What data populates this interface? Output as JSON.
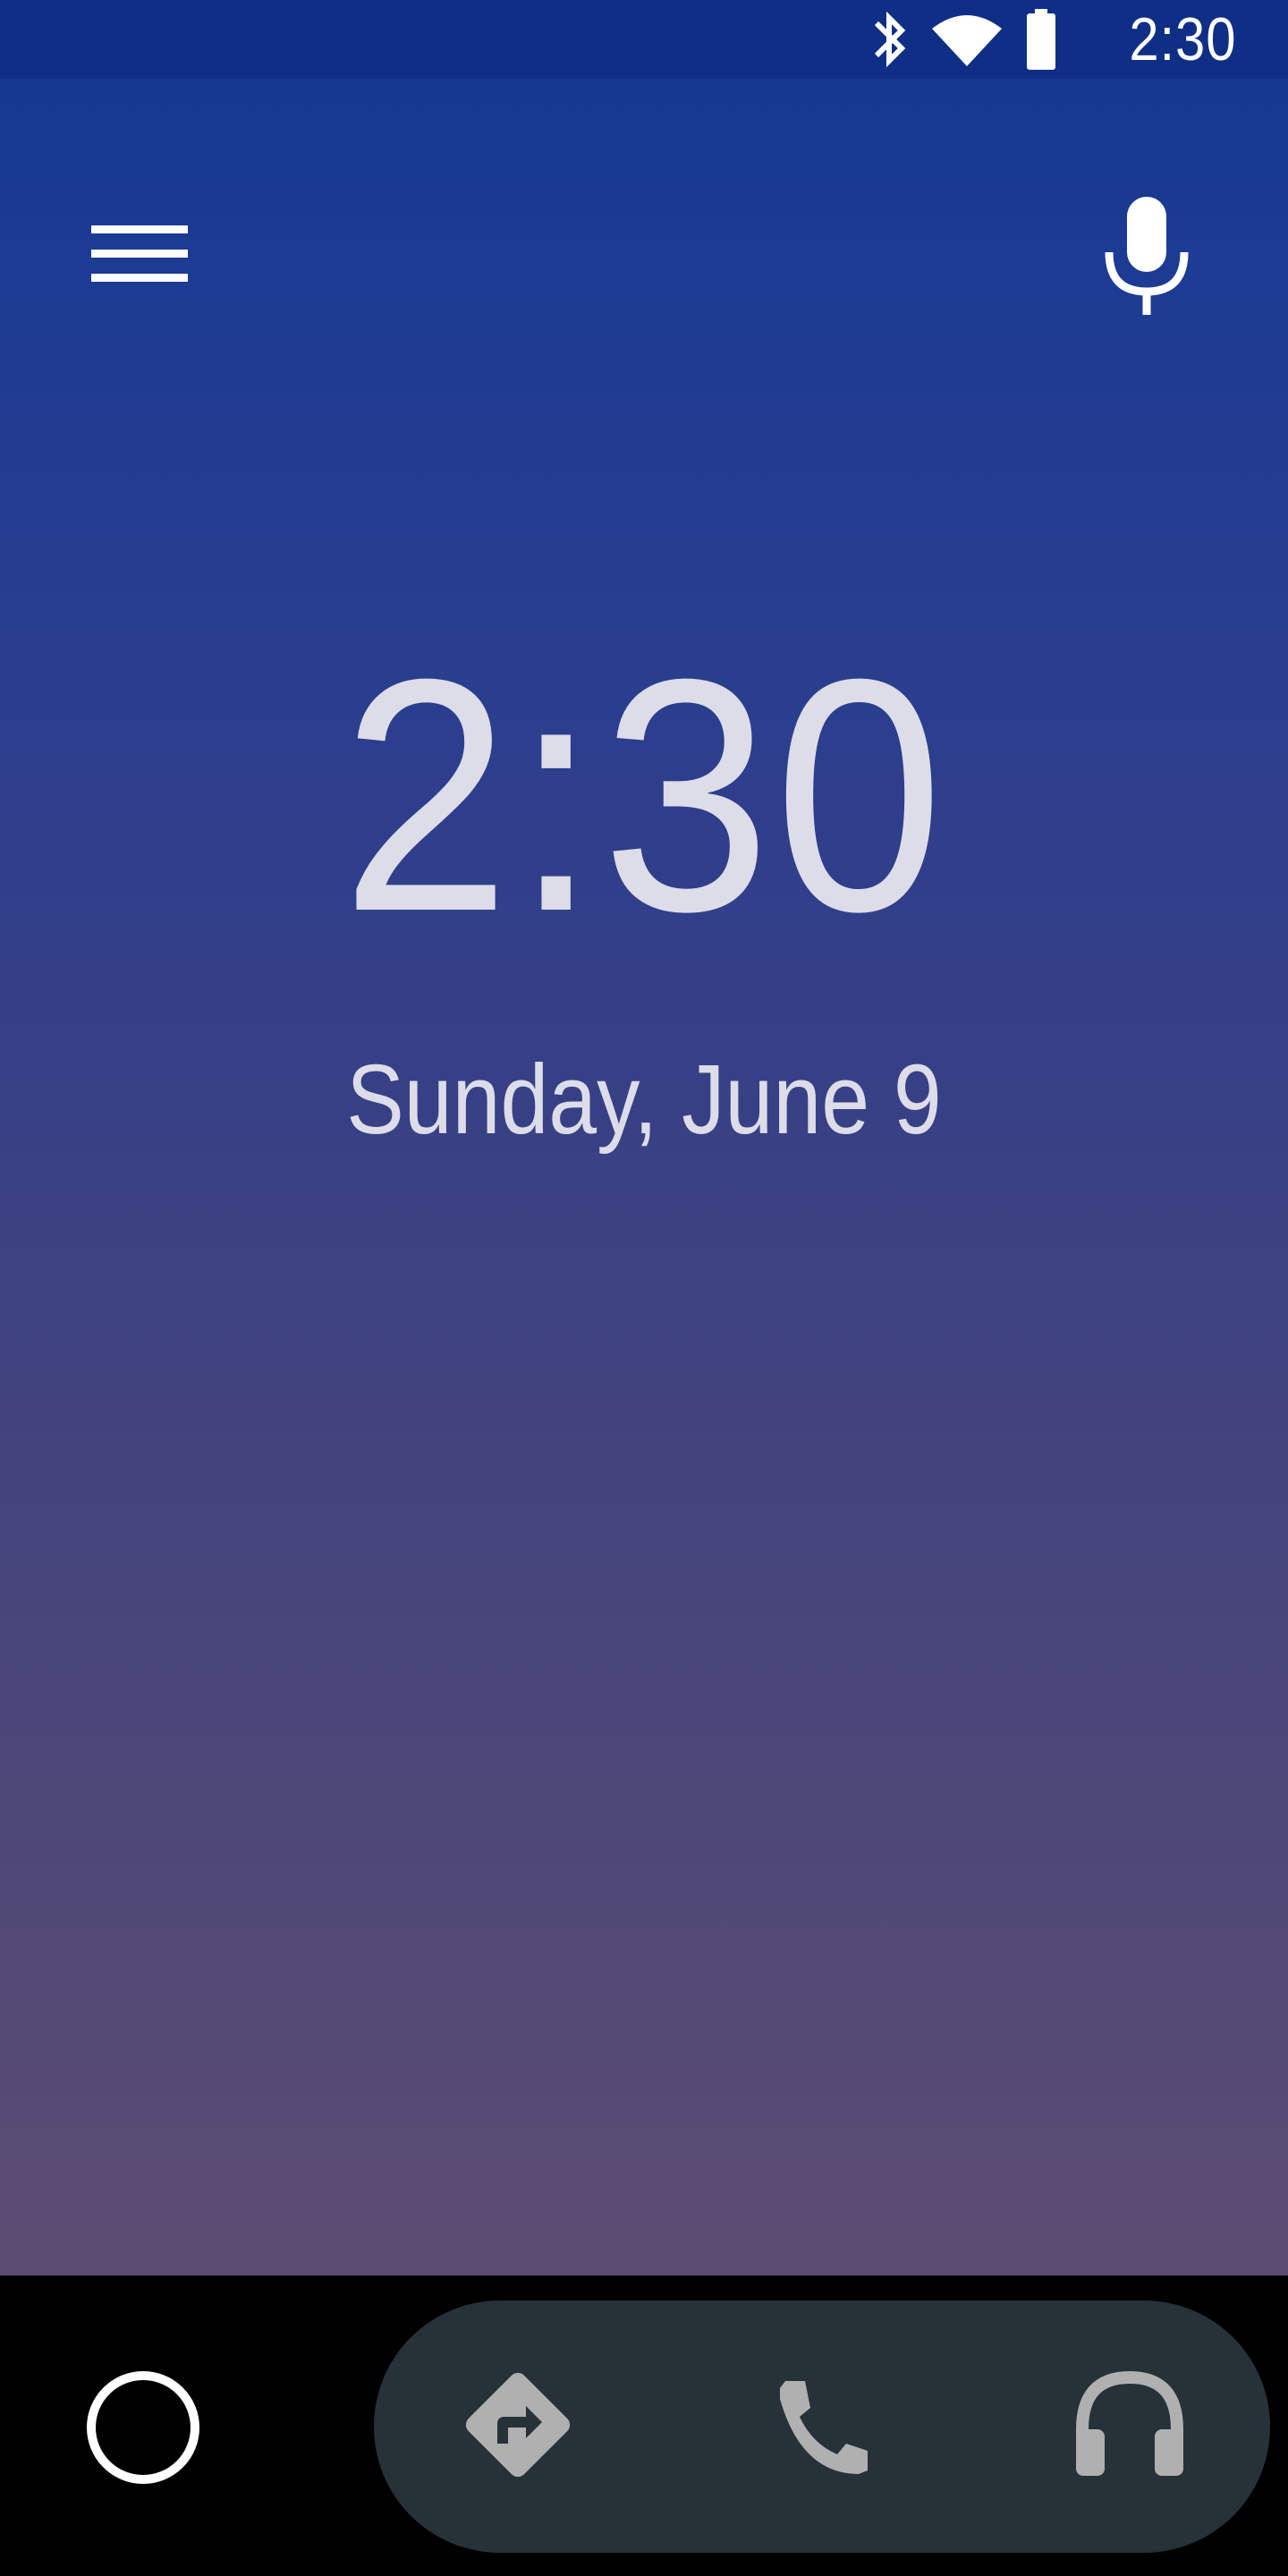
{
  "status_bar": {
    "time": "2:30",
    "icons": [
      "bluetooth-icon",
      "wifi-icon",
      "battery-icon"
    ],
    "background": "#0f2f86"
  },
  "app_bar": {
    "menu_icon": "hamburger-menu-icon",
    "voice_icon": "microphone-icon"
  },
  "clock": {
    "time": "2:30",
    "date": "Sunday, June 9",
    "text_color": "#dcdde9"
  },
  "bottom_nav": {
    "home_icon": "home-circle-icon",
    "dock": [
      {
        "name": "navigation",
        "icon": "directions-icon"
      },
      {
        "name": "phone",
        "icon": "phone-icon"
      },
      {
        "name": "media",
        "icon": "headphones-icon"
      }
    ],
    "dock_color": "#263238",
    "icon_color": "#b0b0b0"
  },
  "colors": {
    "gradient_top": "#13378f",
    "gradient_bottom": "#604e72"
  }
}
